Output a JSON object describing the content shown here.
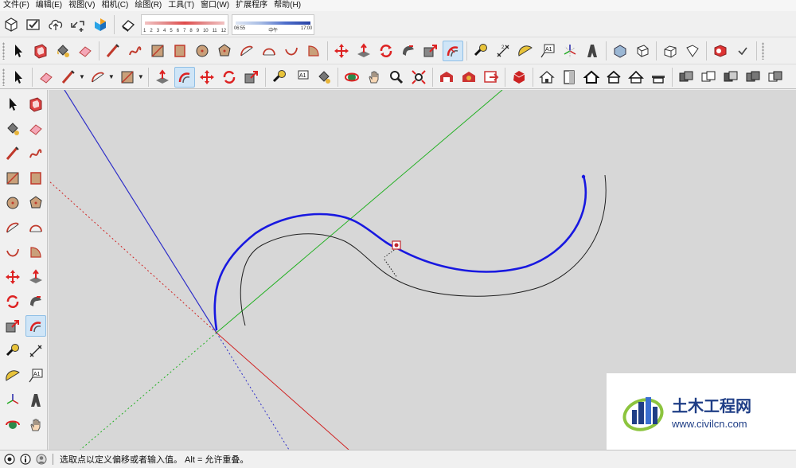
{
  "menubar": {
    "items": [
      "文件(F)",
      "编辑(E)",
      "视图(V)",
      "相机(C)",
      "绘图(R)",
      "工具(T)",
      "窗口(W)",
      "扩展程序",
      "帮助(H)"
    ]
  },
  "shadow_settings": {
    "months": [
      "1",
      "2",
      "3",
      "4",
      "5",
      "6",
      "7",
      "8",
      "9",
      "10",
      "11",
      "12"
    ],
    "time_start": "06:55",
    "time_mid": "中午",
    "time_end": "17:00"
  },
  "colors": {
    "viewport_bg": "#d7d7d7",
    "axis_blue": "#2f2fc8",
    "axis_green": "#22b022",
    "axis_red": "#d02424",
    "selected_curve": "#1818e0",
    "offset_curve": "#202020"
  },
  "icons": {
    "toolbar1": [
      "component-icon",
      "check-icon",
      "cloud-upload-icon",
      "link-plus-icon",
      "extension-icon",
      "eraser-large-icon"
    ],
    "toolbar2": [
      "select-icon",
      "make-component-icon",
      "paint-bucket-icon",
      "eraser-icon",
      "line-icon",
      "freehand-icon",
      "rectangle-icon",
      "rotated-rectangle-icon",
      "circle-icon",
      "polygon-icon",
      "arc-icon",
      "two-point-arc-icon",
      "three-point-arc-icon",
      "pie-icon",
      "move-icon",
      "push-pull-icon",
      "rotate-icon",
      "follow-me-icon",
      "scale-icon",
      "offset-icon",
      "tape-measure-icon",
      "dimension-icon",
      "protractor-icon",
      "text-icon",
      "axes-icon",
      "3d-text-icon",
      "iso-view-icon",
      "top-view-icon",
      "front-view-icon",
      "right-view-icon",
      "back-view-icon",
      "left-view-icon",
      "extension-box-icon",
      "more-icon",
      "toolbar-grip-icon"
    ],
    "toolbar3": [
      "select-icon",
      "eraser-icon",
      "pencil-icon",
      "arc-icon",
      "rectangle-icon",
      "push-pull-icon",
      "offset-icon",
      "move-icon",
      "rotate-icon",
      "scale-icon",
      "tape-measure-icon",
      "text-icon",
      "paint-bucket-icon",
      "orbit-icon",
      "pan-icon",
      "zoom-icon",
      "zoom-extents-icon",
      "warehouse-icon",
      "extension-warehouse-icon",
      "send-to-layout-icon",
      "ruby-icon",
      "house-icon",
      "door-icon",
      "house-outline-icon",
      "house-outline-2-icon",
      "house-outline-3-icon",
      "house-roof-icon",
      "solid-union-icon",
      "solid-subtract-icon",
      "solid-trim-icon",
      "solid-split-icon",
      "solid-outer-shell-icon"
    ],
    "left": [
      "select-icon",
      "make-component-icon",
      "paint-bucket-icon",
      "eraser-icon",
      "line-icon",
      "freehand-icon",
      "rectangle-icon",
      "rotated-rectangle-icon",
      "circle-icon",
      "polygon-icon",
      "arc-icon",
      "pie-icon",
      "three-point-arc-icon",
      "pie-slice-icon",
      "move-icon",
      "push-pull-icon",
      "rotate-icon",
      "follow-me-icon",
      "scale-icon",
      "offset-icon",
      "tape-measure-icon",
      "dimension-icon",
      "protractor-icon",
      "text-icon",
      "axes-icon",
      "3d-text-icon",
      "orbit-icon",
      "pan-icon"
    ]
  },
  "watermark": {
    "title": "土木工程网",
    "url": "www.civilcn.com"
  },
  "status": {
    "text": "选取点以定义偏移或者输入值。 Alt = 允许重叠。"
  }
}
